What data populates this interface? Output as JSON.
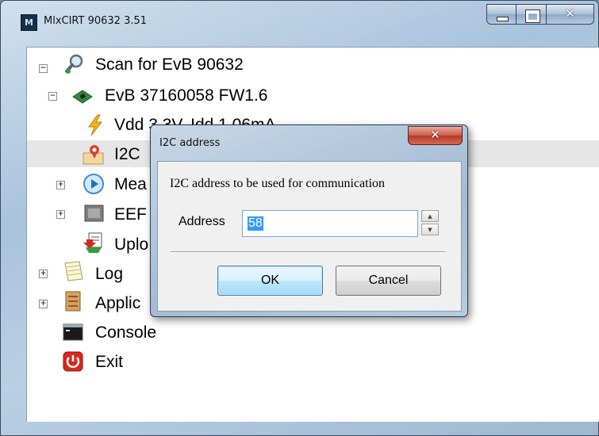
{
  "window": {
    "title": "MlxCIRT 90632 3.51",
    "icon_text": "M"
  },
  "tree": {
    "items": [
      {
        "label": "Scan for EvB 90632",
        "icon": "magnifier-icon",
        "expander": "−"
      },
      {
        "label": "EvB 37160058 FW1.6",
        "icon": "circuit-board-icon",
        "expander": "−"
      },
      {
        "label": "Vdd 3.3V, Idd 1.06mA",
        "icon": "lightning-icon"
      },
      {
        "label": "I2C",
        "icon": "map-pin-icon"
      },
      {
        "label": "Mea",
        "icon": "play-circle-icon",
        "expander": "+"
      },
      {
        "label": "EEF",
        "icon": "memory-chip-icon",
        "expander": "+"
      },
      {
        "label": "Uplo",
        "icon": "upload-icon"
      },
      {
        "label": "Log",
        "icon": "notepad-icon",
        "expander": "+"
      },
      {
        "label": "Applic",
        "icon": "application-icon",
        "expander": "+"
      },
      {
        "label": "Console",
        "icon": "console-icon"
      },
      {
        "label": "Exit",
        "icon": "power-icon"
      }
    ]
  },
  "dialog": {
    "title": "I2C address",
    "prompt": "I2C address to be used for communication",
    "address_label": "Address",
    "address_value": "58",
    "ok_label": "OK",
    "cancel_label": "Cancel"
  },
  "colors": {
    "selection": "#3399ff",
    "window_frame": "#a9c3dc",
    "close_button": "#c8412e"
  }
}
